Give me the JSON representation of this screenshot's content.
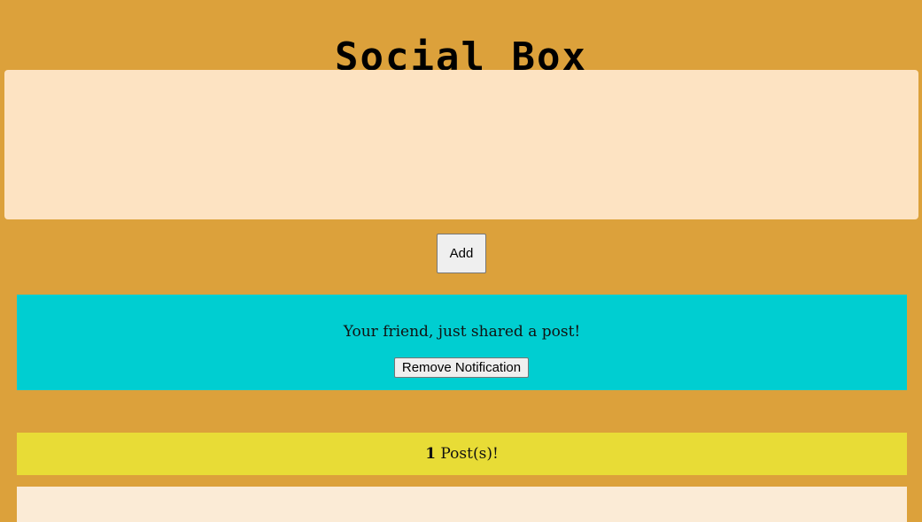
{
  "app": {
    "title": "Social Box"
  },
  "composer": {
    "value": "",
    "placeholder": ""
  },
  "add_button": {
    "label": "Add"
  },
  "notification": {
    "message": "Your friend, just shared a post!",
    "remove_label": "Remove Notification"
  },
  "posts": {
    "count": "1",
    "count_suffix": " Post(s)!"
  },
  "colors": {
    "background": "#dca13b",
    "composer": "#fde3c2",
    "notification": "#00ced1",
    "post_count": "#e8dc36",
    "post_card": "#fbebd6"
  }
}
